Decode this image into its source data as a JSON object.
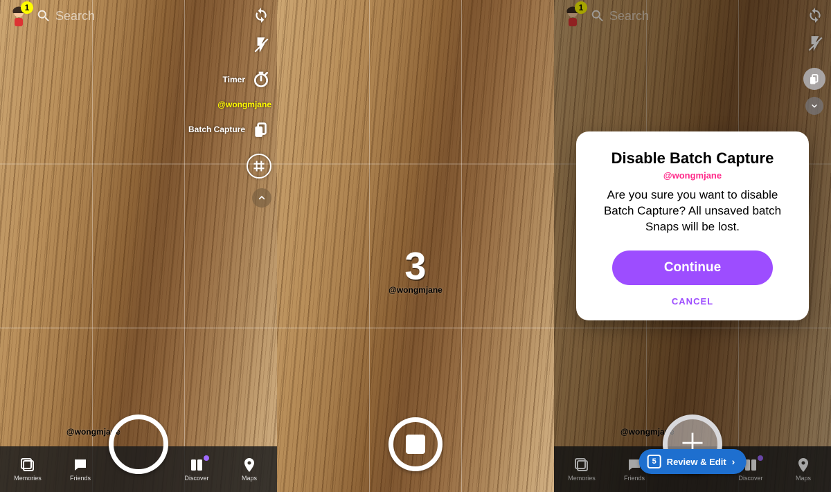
{
  "colors": {
    "accentYellow": "#FFFC00",
    "purple": "#9d4dff",
    "pink": "#ff2b8a",
    "bluePill": "#1e6fcf"
  },
  "user": {
    "handleWatermark": "@wongmjane",
    "badgeCount": "1"
  },
  "search": {
    "placeholder": "Search"
  },
  "panel1": {
    "tools": {
      "timerLabel": "Timer",
      "handle": "@wongmjane",
      "batchCaptureLabel": "Batch Capture"
    }
  },
  "panel2": {
    "countdownValue": "3",
    "handle": "@wongmjane"
  },
  "panel3": {
    "dialog": {
      "title": "Disable Batch Capture",
      "handle": "@wongmjane",
      "body": "Are you sure you want to disable Batch Capture? All unsaved batch Snaps will be lost.",
      "primary": "Continue",
      "cancel": "CANCEL"
    },
    "review": {
      "count": "5",
      "label": "Review & Edit"
    }
  },
  "nav": {
    "memories": "Memories",
    "friends": "Friends",
    "discover": "Discover",
    "maps": "Maps"
  }
}
